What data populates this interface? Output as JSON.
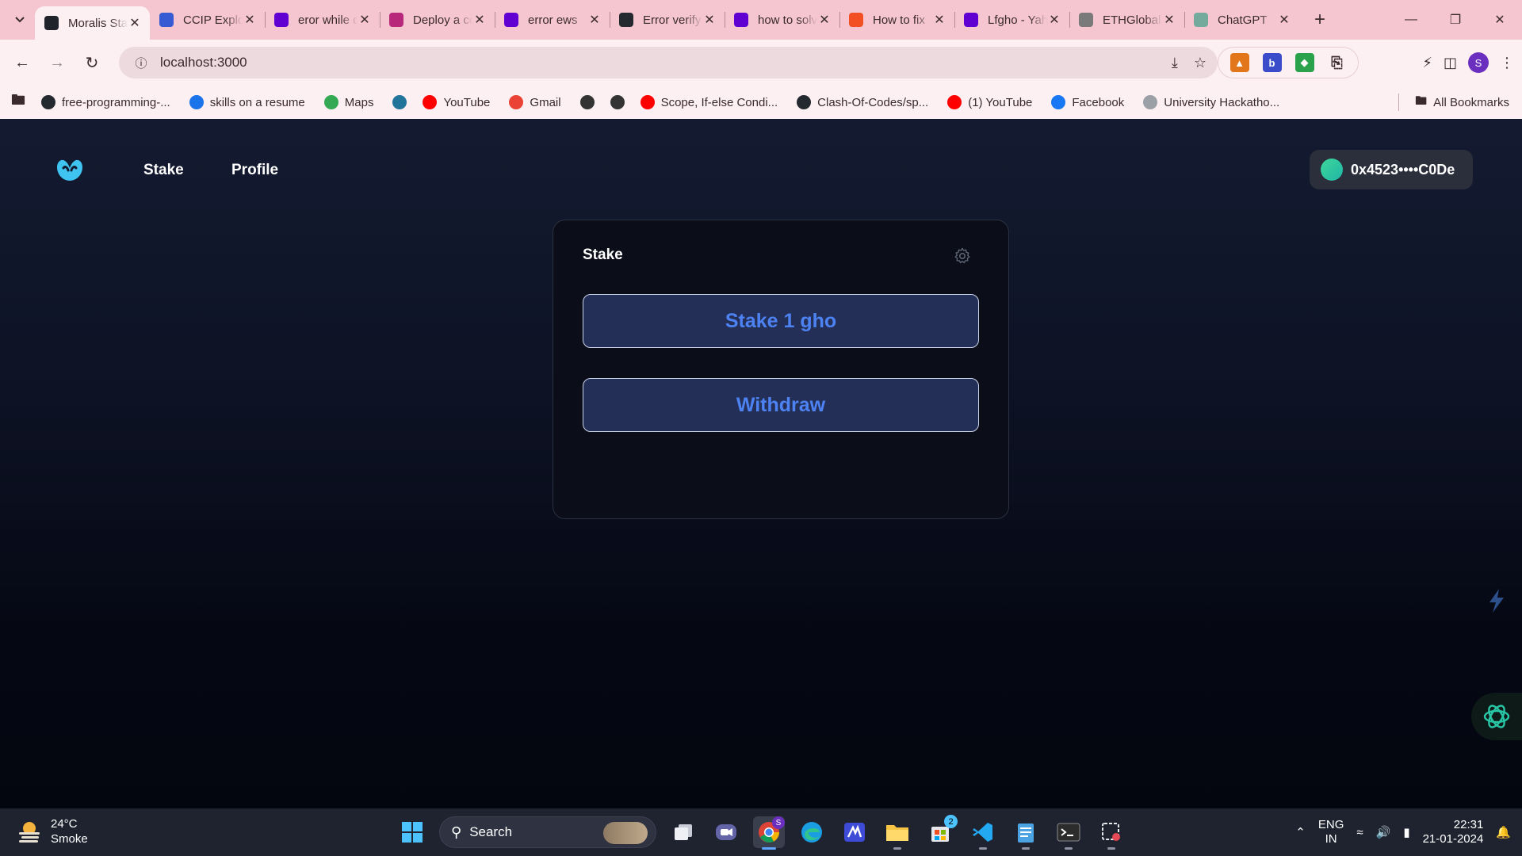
{
  "browser": {
    "tabs": [
      {
        "title": "Moralis Stake",
        "favicon": "react-icon",
        "color": "#20232a",
        "active": true
      },
      {
        "title": "CCIP Explorer",
        "favicon": "chainlink-icon",
        "color": "#375bd2"
      },
      {
        "title": "eror while deploying",
        "favicon": "yahoo-icon",
        "color": "#6001d2"
      },
      {
        "title": "Deploy a contract",
        "favicon": "moralis-icon",
        "color": "#b7287a"
      },
      {
        "title": "error ews",
        "favicon": "yahoo-icon",
        "color": "#6001d2"
      },
      {
        "title": "Error verifying",
        "favicon": "github-icon",
        "color": "#24292f"
      },
      {
        "title": "how to solve",
        "favicon": "yahoo-icon",
        "color": "#6001d2"
      },
      {
        "title": "How to fix",
        "favicon": "microsoft-icon",
        "color": "#f25022"
      },
      {
        "title": "Lfgho - Yahoo",
        "favicon": "yahoo-icon",
        "color": "#6001d2"
      },
      {
        "title": "ETHGlobal",
        "favicon": "ethglobal-icon",
        "color": "#7a7a7a"
      },
      {
        "title": "ChatGPT",
        "favicon": "chatgpt-icon",
        "color": "#74aa9c"
      }
    ],
    "url": "localhost:3000",
    "profile_initial": "S",
    "bookmarks": [
      {
        "label": "free-programming-...",
        "icon": "github-icon",
        "color": "#24292f"
      },
      {
        "label": "skills on a resume",
        "icon": "bookmark-icon",
        "color": "#1a73e8"
      },
      {
        "label": "Maps",
        "icon": "maps-icon",
        "color": "#34a853"
      },
      {
        "label": "",
        "icon": "wordpress-icon",
        "color": "#21759b"
      },
      {
        "label": "YouTube",
        "icon": "youtube-icon",
        "color": "#ff0000"
      },
      {
        "label": "Gmail",
        "icon": "gmail-icon",
        "color": "#ea4335"
      },
      {
        "label": "",
        "icon": "globe-icon",
        "color": "#333333"
      },
      {
        "label": "",
        "icon": "globe-icon",
        "color": "#333333"
      },
      {
        "label": "Scope, If-else Condi...",
        "icon": "youtube-icon",
        "color": "#ff0000"
      },
      {
        "label": "Clash-Of-Codes/sp...",
        "icon": "github-icon",
        "color": "#24292f"
      },
      {
        "label": "(1) YouTube",
        "icon": "youtube-icon",
        "color": "#ff0000"
      },
      {
        "label": "Facebook",
        "icon": "facebook-icon",
        "color": "#1877f2"
      },
      {
        "label": "University Hackatho...",
        "icon": "site-icon",
        "color": "#9aa0a6"
      }
    ],
    "all_bookmarks": "All Bookmarks"
  },
  "nav": {
    "links": [
      "Stake",
      "Profile"
    ],
    "wallet_address": "0x4523••••C0De"
  },
  "card": {
    "title": "Stake",
    "stake_button": "Stake 1 gho",
    "withdraw_button": "Withdraw"
  },
  "taskbar": {
    "temperature": "24°C",
    "weather": "Smoke",
    "search_label": "Search",
    "store_badge": "2",
    "chrome_badge": "S",
    "lang_top": "ENG",
    "lang_bottom": "IN",
    "time": "22:31",
    "date": "21-01-2024"
  },
  "colors": {
    "accent": "#4d82f3",
    "button_bg": "#242f57",
    "logo": "#3fc3f0"
  }
}
